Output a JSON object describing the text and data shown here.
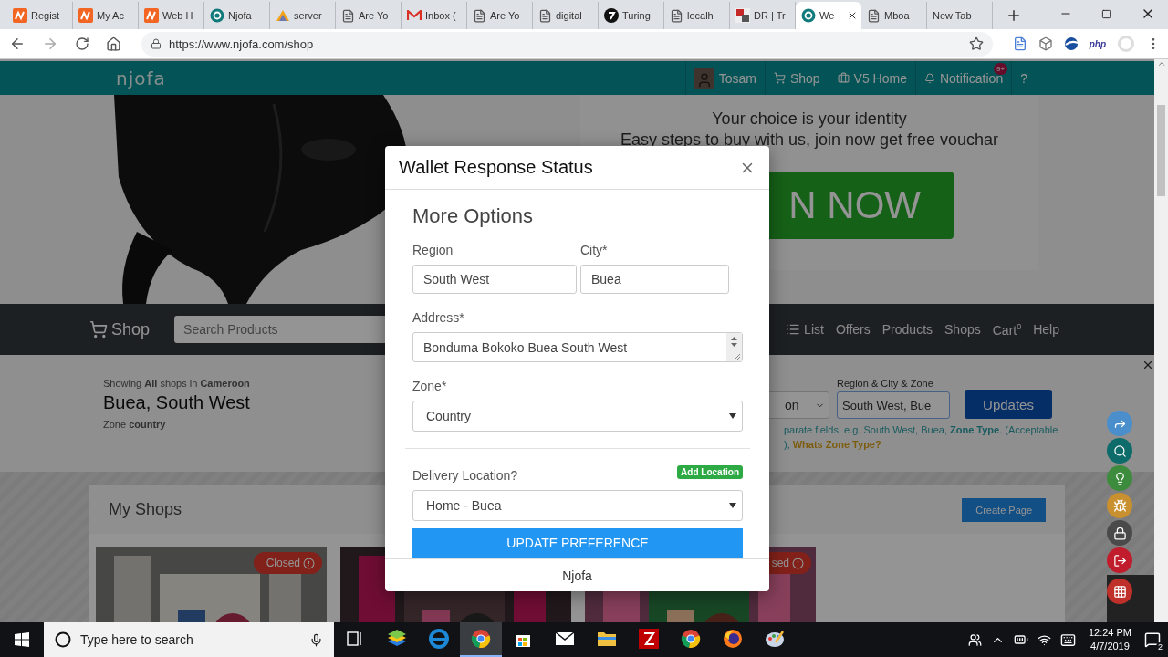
{
  "browser": {
    "tabs": [
      {
        "title": "Regist",
        "kind": "orange",
        "selected": false
      },
      {
        "title": "My Ac",
        "kind": "orange",
        "selected": false
      },
      {
        "title": "Web H",
        "kind": "orange",
        "selected": false
      },
      {
        "title": "Njofa",
        "kind": "globe",
        "selected": false
      },
      {
        "title": "server",
        "kind": "sail",
        "selected": false
      },
      {
        "title": "Are Yo",
        "kind": "page",
        "selected": false
      },
      {
        "title": "Inbox (",
        "kind": "mail",
        "selected": false
      },
      {
        "title": "Are Yo",
        "kind": "page",
        "selected": false
      },
      {
        "title": "digital",
        "kind": "page",
        "selected": false
      },
      {
        "title": "Turing",
        "kind": "circle",
        "selected": false
      },
      {
        "title": "localh",
        "kind": "page",
        "selected": false
      },
      {
        "title": "DR | Tr",
        "kind": "flag",
        "selected": false
      },
      {
        "title": "We",
        "kind": "globe",
        "selected": true
      },
      {
        "title": "Mboa",
        "kind": "page",
        "selected": false
      },
      {
        "title": "New Tab",
        "kind": "none",
        "selected": false
      }
    ],
    "url": "https://www.njofa.com/shop",
    "extension_label": "php"
  },
  "site_header": {
    "logo": "njofa",
    "items": [
      {
        "label": "Tosam",
        "kind": "avatar"
      },
      {
        "label": "Shop",
        "kind": "cart"
      },
      {
        "label": "V5 Home",
        "kind": "briefcase"
      },
      {
        "label": "Notification",
        "kind": "bell",
        "badge": "9+"
      },
      {
        "label": "?",
        "kind": "plain"
      }
    ]
  },
  "hero": {
    "tagline": "Your choice is your identity",
    "subline": "Easy steps to buy with us, join now get free vouchar",
    "button": "N NOW"
  },
  "nav": {
    "brand": "Shop",
    "search_placeholder": "Search Products",
    "links": [
      {
        "label": "List",
        "kind": "list"
      },
      {
        "label": "Offers",
        "kind": "plain"
      },
      {
        "label": "Products",
        "kind": "plain"
      },
      {
        "label": "Shops",
        "kind": "plain"
      },
      {
        "label": "Cart",
        "kind": "count",
        "count": "0"
      },
      {
        "label": "Help",
        "kind": "plain"
      }
    ]
  },
  "location": {
    "showing": "Showing  **All**  shops in **Cameroon**",
    "place": "Buea, South West",
    "zone": "Zone **country**",
    "region_select": "on",
    "field_label": "Region & City & Zone",
    "field_value": "South West, Bue",
    "update_button": "Updates",
    "hint": "parate fields. e.g. South West, Buea, **Zone Type**.   (Acceptable",
    "hint_prefix": "),",
    "zone_link": "Whats Zone Type?"
  },
  "shops": {
    "title": "My Shops",
    "create_button": "Create Page",
    "cards": [
      {
        "kind": "picture",
        "status": "Closed"
      },
      {
        "kind": "picture"
      },
      {
        "kind": "picture",
        "status": "sed"
      }
    ]
  },
  "float_buttons": [
    {
      "kind": "share",
      "color": "#4a8fcc"
    },
    {
      "kind": "search",
      "color": "#0d6b6a"
    },
    {
      "kind": "bulb",
      "color": "#3d8c3d"
    },
    {
      "kind": "bug",
      "color": "#c8902e"
    },
    {
      "kind": "lock",
      "color": "#4a4a4a"
    },
    {
      "kind": "logout",
      "color": "#c01c2c"
    },
    {
      "kind": "grid",
      "color": "#c0302a"
    }
  ],
  "modal": {
    "title": "Wallet Response Status",
    "heading": "More Options",
    "region": {
      "label": "Region",
      "value": "South West"
    },
    "city": {
      "label": "City*",
      "value": "Buea"
    },
    "address": {
      "label": "Address*",
      "value": "Bonduma Bokoko Buea South West"
    },
    "zone": {
      "label": "Zone*",
      "value": "Country"
    },
    "delivery": {
      "label": "Delivery Location?",
      "add_button": "Add Location",
      "value": "Home - Buea"
    },
    "submit": "UPDATE PREFERENCE",
    "footer": "Njofa"
  },
  "taskbar": {
    "search_placeholder": "Type here to search",
    "apps": [
      {
        "kind": "taskview",
        "selected": false
      },
      {
        "kind": "bluestacks",
        "selected": false
      },
      {
        "kind": "edge",
        "selected": false
      },
      {
        "kind": "chrome",
        "selected": true
      },
      {
        "kind": "store",
        "selected": false
      },
      {
        "kind": "mail",
        "selected": false
      },
      {
        "kind": "files",
        "selected": false
      },
      {
        "kind": "filezilla",
        "selected": false
      },
      {
        "kind": "chrome",
        "selected": false
      },
      {
        "kind": "firefox",
        "selected": false
      },
      {
        "kind": "paint",
        "selected": false
      }
    ],
    "time": "12:24 PM",
    "date": "4/7/2019",
    "notifications": "2"
  }
}
